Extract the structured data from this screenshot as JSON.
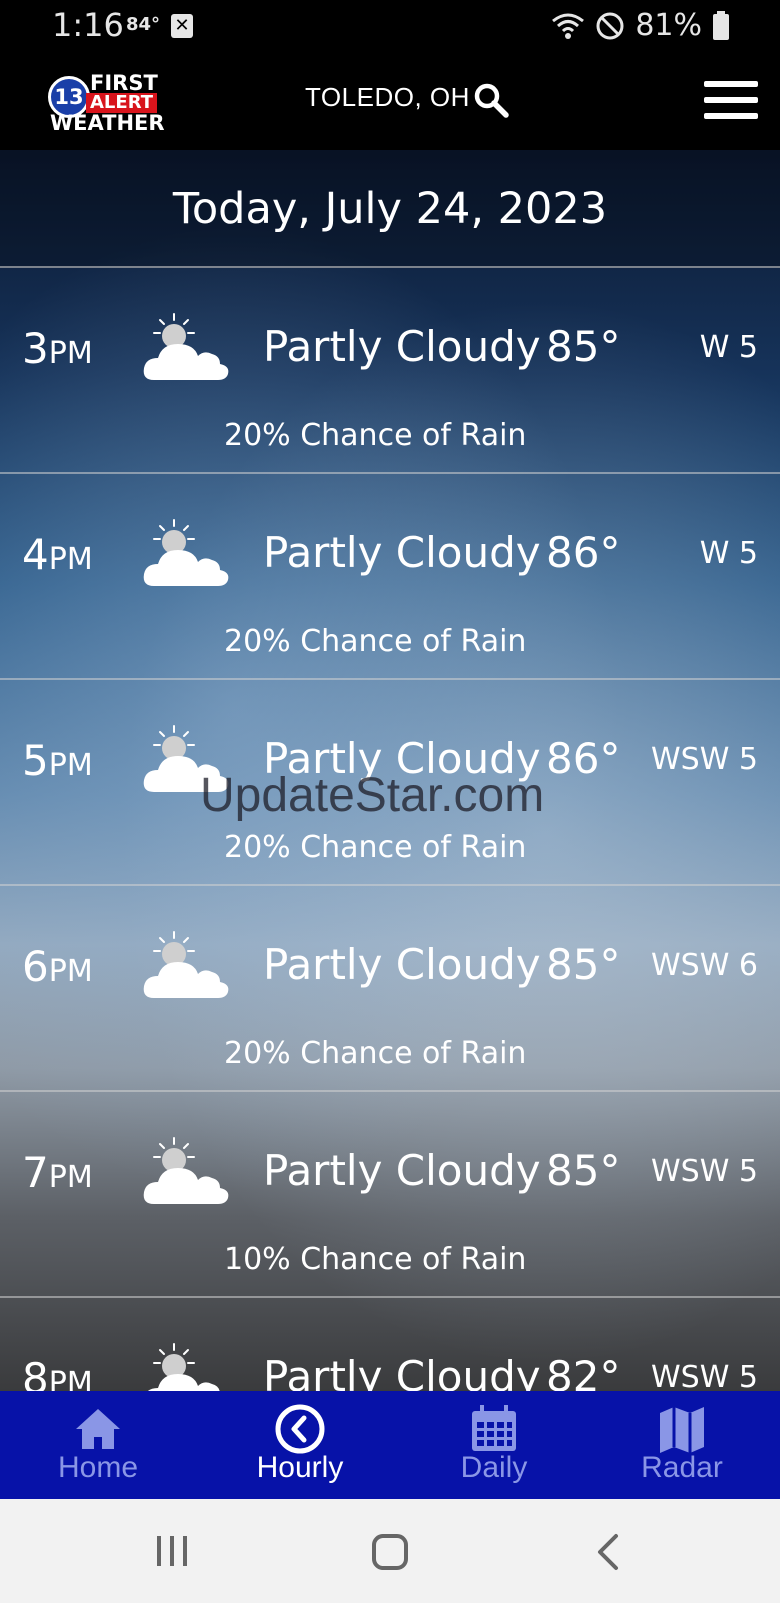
{
  "status_bar": {
    "time": "1:16",
    "temp": "84°",
    "battery": "81%"
  },
  "header": {
    "logo": {
      "number": "13",
      "line1": "FIRST",
      "line2": "ALERT",
      "line3": "WEATHER"
    },
    "location": "TOLEDO, OH"
  },
  "date_header": "Today, July 24, 2023",
  "hours": [
    {
      "hour": "3",
      "ampm": "PM",
      "condition": "Partly Cloudy",
      "temp": "85°",
      "wind": "W 5",
      "rain": "20% Chance of Rain"
    },
    {
      "hour": "4",
      "ampm": "PM",
      "condition": "Partly Cloudy",
      "temp": "86°",
      "wind": "W 5",
      "rain": "20% Chance of Rain"
    },
    {
      "hour": "5",
      "ampm": "PM",
      "condition": "Partly Cloudy",
      "temp": "86°",
      "wind": "WSW 5",
      "rain": "20% Chance of Rain"
    },
    {
      "hour": "6",
      "ampm": "PM",
      "condition": "Partly Cloudy",
      "temp": "85°",
      "wind": "WSW 6",
      "rain": "20% Chance of Rain"
    },
    {
      "hour": "7",
      "ampm": "PM",
      "condition": "Partly Cloudy",
      "temp": "85°",
      "wind": "WSW 5",
      "rain": "10% Chance of Rain"
    },
    {
      "hour": "8",
      "ampm": "PM",
      "condition": "Partly Cloudy",
      "temp": "82°",
      "wind": "WSW 5",
      "rain": ""
    }
  ],
  "watermark": "UpdateStar.com",
  "nav": {
    "home": "Home",
    "hourly": "Hourly",
    "daily": "Daily",
    "radar": "Radar",
    "active": "hourly"
  },
  "colors": {
    "nav_bg": "#0712a8",
    "nav_inactive": "#8a96e6",
    "alert_red": "#d8141c"
  }
}
